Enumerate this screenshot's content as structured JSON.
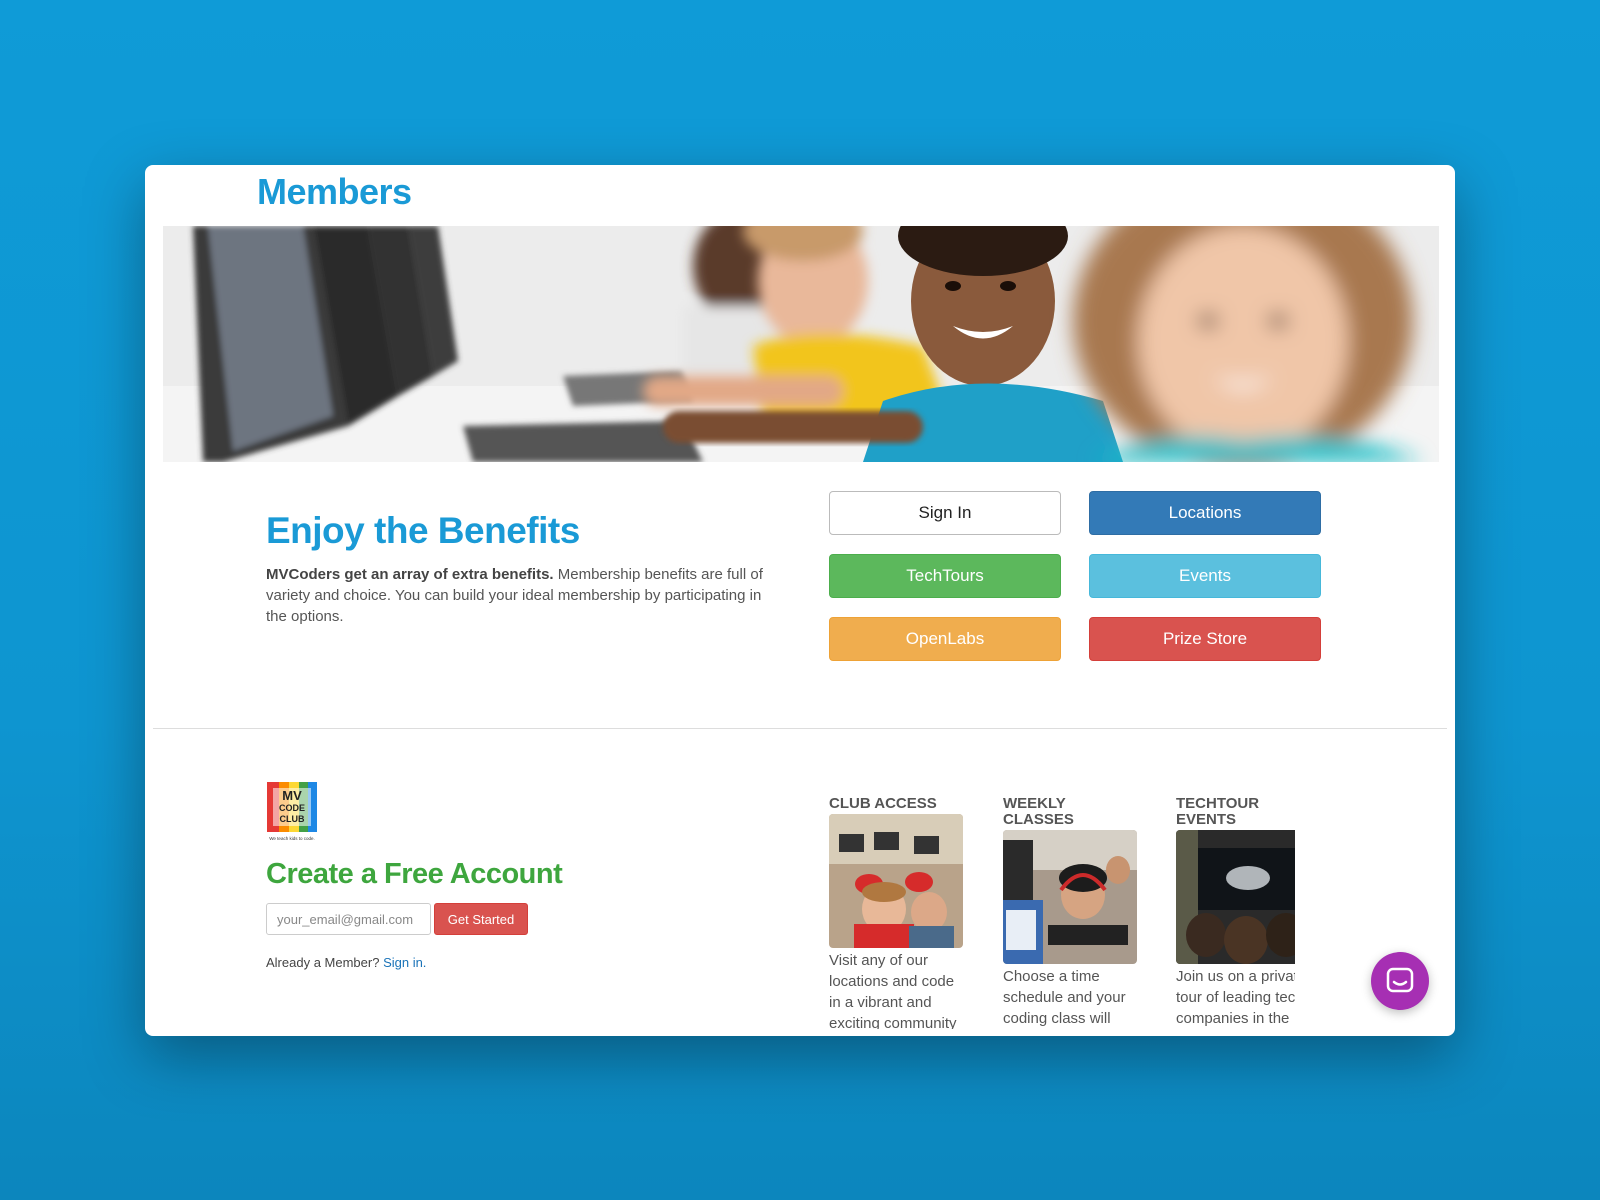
{
  "page": {
    "title": "Members"
  },
  "benefits": {
    "title": "Enjoy the Benefits",
    "lead_bold": "MVCoders get an array of extra benefits.",
    "lead_text": " Membership benefits are full of variety and choice. You can build your ideal membership by participating in the options."
  },
  "buttons": {
    "sign_in": "Sign In",
    "locations": "Locations",
    "techtours": "TechTours",
    "events": "Events",
    "openlabs": "OpenLabs",
    "prize_store": "Prize Store"
  },
  "signup": {
    "logo_lines": [
      "MV",
      "CODE",
      "CLUB"
    ],
    "logo_tagline": "We teach kids to code.",
    "title": "Create a Free Account",
    "email_placeholder": "your_email@gmail.com",
    "get_started": "Get Started",
    "already_text": "Already a Member? ",
    "signin_link": "Sign in."
  },
  "features": [
    {
      "title": "CLUB ACCESS",
      "text": "Visit any of our locations and code in a vibrant and exciting community"
    },
    {
      "title": "WEEKLY CLASSES",
      "text": "Choose a time schedule and your coding class will happen once per"
    },
    {
      "title": "TECHTOUR EVENTS",
      "text": "Join us on a private tour of leading tech companies in the"
    }
  ],
  "icons": {
    "chat": "chat-bubble-icon"
  },
  "colors": {
    "accent_blue": "#1a9ad6",
    "green_title": "#3ea63e",
    "primary": "#337ab7",
    "success": "#5cb85c",
    "info": "#5bc0de",
    "warning": "#f0ad4e",
    "danger": "#d9534f",
    "chat": "#a62fb3"
  }
}
